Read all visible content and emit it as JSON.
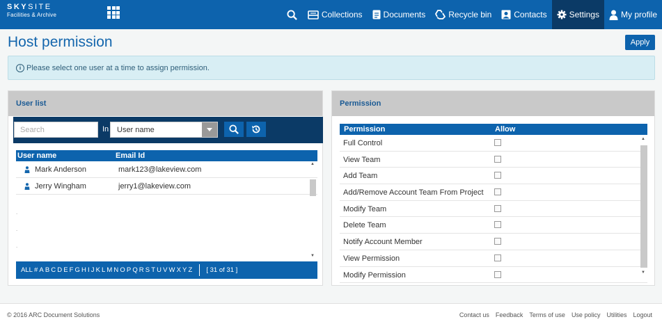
{
  "app": {
    "logo_line1_bold": "SKY",
    "logo_line1_rest": "SITE",
    "logo_line2": "Facilities & Archive"
  },
  "nav": {
    "items": [
      {
        "label": "Collections",
        "icon": "collections-icon"
      },
      {
        "label": "Documents",
        "icon": "documents-icon"
      },
      {
        "label": "Recycle bin",
        "icon": "recycle-icon"
      },
      {
        "label": "Contacts",
        "icon": "contacts-icon"
      },
      {
        "label": "Settings",
        "icon": "gear-icon",
        "active": true
      },
      {
        "label": "My profile",
        "icon": "user-icon"
      }
    ]
  },
  "page": {
    "title": "Host permission",
    "apply_label": "Apply",
    "info_message": "Please select one user at a time to assign permission."
  },
  "user_list": {
    "title": "User list",
    "search_placeholder": "Search",
    "in_label": "In",
    "search_field_selected": "User name",
    "columns": [
      "User name",
      "Email Id"
    ],
    "rows": [
      {
        "name": "Mark Anderson",
        "email": "mark123@lakeview.com"
      },
      {
        "name": "Jerry Wingham",
        "email": "jerry1@lakeview.com"
      }
    ],
    "alpha_all": "ALL",
    "alpha_hash": "#",
    "letters": [
      "A",
      "B",
      "C",
      "D",
      "E",
      "F",
      "G",
      "H",
      "I",
      "J",
      "K",
      "L",
      "M",
      "N",
      "O",
      "P",
      "Q",
      "R",
      "S",
      "T",
      "U",
      "V",
      "W",
      "X",
      "Y",
      "Z"
    ],
    "count_label": "[ 31 of 31 ]"
  },
  "permission": {
    "title": "Permission",
    "columns": [
      "Permission",
      "Allow"
    ],
    "rows": [
      "Full Control",
      "View Team",
      "Add Team",
      "Add/Remove Account Team From Project",
      "Modify Team",
      "Delete Team",
      "Notify Account Member",
      "View Permission",
      "Modify Permission"
    ]
  },
  "footer": {
    "copyright": "© 2016 ARC Document Solutions",
    "links": [
      "Contact us",
      "Feedback",
      "Terms of use",
      "Use policy",
      "Utilities",
      "Logout"
    ]
  },
  "colors": {
    "primary": "#0d63ad",
    "dark_navy": "#0b3a66",
    "panel_header": "#c9c9c9",
    "info_bg": "#d8eef4"
  }
}
